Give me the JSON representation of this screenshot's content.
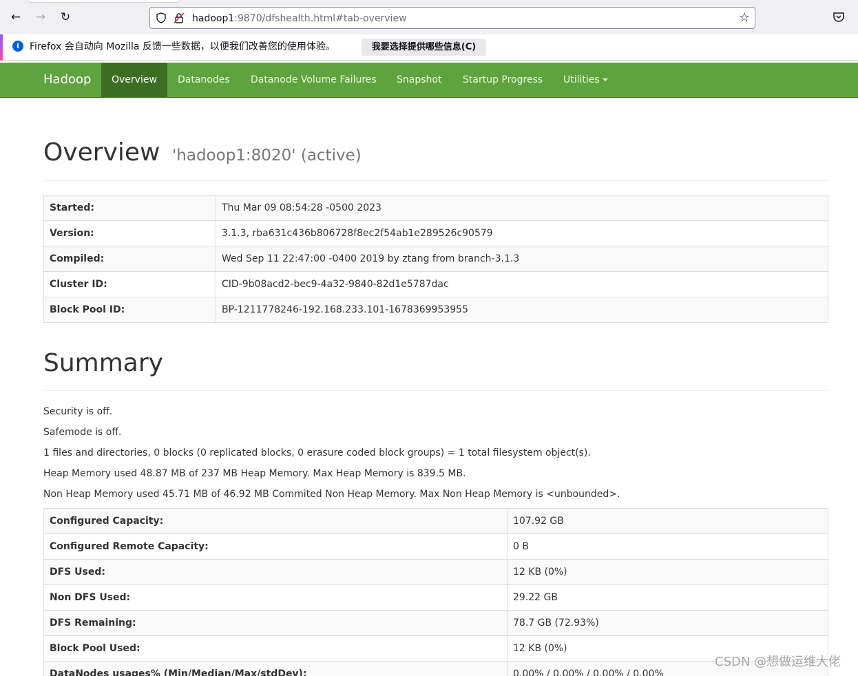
{
  "browser": {
    "url_host": "hadoop1",
    "url_rest": ":9870/dfshealth.html#tab-overview"
  },
  "notification": {
    "message": "Firefox 会自动向 Mozilla 反馈一些数据，以便我们改善您的使用体验。",
    "button_label": "我要选择提供哪些信息(C)"
  },
  "navbar": {
    "brand": "Hadoop",
    "items": [
      "Overview",
      "Datanodes",
      "Datanode Volume Failures",
      "Snapshot",
      "Startup Progress",
      "Utilities"
    ]
  },
  "overview": {
    "title": "Overview",
    "subtitle": "'hadoop1:8020' (active)",
    "rows": [
      {
        "key": "Started:",
        "value": "Thu Mar 09 08:54:28 -0500 2023"
      },
      {
        "key": "Version:",
        "value": "3.1.3, rba631c436b806728f8ec2f54ab1e289526c90579"
      },
      {
        "key": "Compiled:",
        "value": "Wed Sep 11 22:47:00 -0400 2019 by ztang from branch-3.1.3"
      },
      {
        "key": "Cluster ID:",
        "value": "CID-9b08acd2-bec9-4a32-9840-82d1e5787dac"
      },
      {
        "key": "Block Pool ID:",
        "value": "BP-1211778246-192.168.233.101-1678369953955"
      }
    ]
  },
  "summary": {
    "title": "Summary",
    "lines": [
      "Security is off.",
      "Safemode is off.",
      "1 files and directories, 0 blocks (0 replicated blocks, 0 erasure coded block groups) = 1 total filesystem object(s).",
      "Heap Memory used 48.87 MB of 237 MB Heap Memory. Max Heap Memory is 839.5 MB.",
      "Non Heap Memory used 45.71 MB of 46.92 MB Commited Non Heap Memory. Max Non Heap Memory is <unbounded>."
    ],
    "rows": [
      {
        "key": "Configured Capacity:",
        "value": "107.92 GB"
      },
      {
        "key": "Configured Remote Capacity:",
        "value": "0 B"
      },
      {
        "key": "DFS Used:",
        "value": "12 KB (0%)"
      },
      {
        "key": "Non DFS Used:",
        "value": "29.22 GB"
      },
      {
        "key": "DFS Remaining:",
        "value": "78.7 GB (72.93%)"
      },
      {
        "key": "Block Pool Used:",
        "value": "12 KB (0%)"
      },
      {
        "key": "DataNodes usages% (Min/Median/Max/stdDev):",
        "value": "0.00% / 0.00% / 0.00% / 0.00%"
      }
    ]
  },
  "watermark": "CSDN @想做运维大佬"
}
